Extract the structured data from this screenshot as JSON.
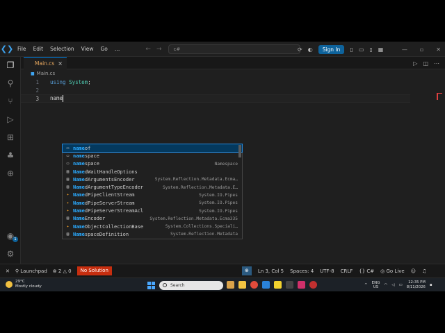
{
  "titlebar": {
    "menu": [
      "File",
      "Edit",
      "Selection",
      "View",
      "Go",
      "…"
    ],
    "search_text": "c#",
    "signin_label": "Sign In"
  },
  "tab": {
    "filename": "Main.cs",
    "close": "×"
  },
  "breadcrumb": {
    "file": "Main.cs"
  },
  "editor": {
    "lines": [
      {
        "num": "1",
        "keyword": "using",
        "ns": "System",
        "semi": ";"
      },
      {
        "num": "2"
      },
      {
        "num": "3",
        "text": "name"
      }
    ]
  },
  "suggest": {
    "items": [
      {
        "match": "name",
        "rest": "of",
        "detail": "",
        "icon": "keyword-icon"
      },
      {
        "match": "name",
        "rest": "space",
        "detail": "",
        "icon": "keyword-icon"
      },
      {
        "match": "name",
        "rest": "space",
        "detail": "Namespace",
        "icon": "snippet-icon"
      },
      {
        "match": "Name",
        "rest": "dWaitHandleOptions",
        "detail": "",
        "icon": "struct-icon"
      },
      {
        "match": "Name",
        "rest": "dArgumentsEncoder",
        "detail": "System.Reflection.Metadata.Ecma…",
        "icon": "struct-icon"
      },
      {
        "match": "Name",
        "rest": "dArgumentTypeEncoder",
        "detail": "System.Reflection.Metadata.E…",
        "icon": "struct-icon"
      },
      {
        "match": "Name",
        "rest": "dPipeClientStream",
        "detail": "System.IO.Pipes",
        "icon": "class-icon"
      },
      {
        "match": "Name",
        "rest": "dPipeServerStream",
        "detail": "System.IO.Pipes",
        "icon": "class-icon"
      },
      {
        "match": "Name",
        "rest": "dPipeServerStreamAcl",
        "detail": "System.IO.Pipes",
        "icon": "class-icon"
      },
      {
        "match": "Name",
        "rest": "Encoder",
        "detail": "System.Reflection.Metadata.Ecma335",
        "icon": "struct-icon"
      },
      {
        "match": "Name",
        "rest": "ObjectCollectionBase",
        "detail": "System.Collections.Speciali…",
        "icon": "class-icon"
      },
      {
        "match": "Name",
        "rest": "spaceDefinition",
        "detail": "System.Reflection.Metadata",
        "icon": "struct-icon"
      }
    ]
  },
  "statusbar": {
    "launchpad": "Launchpad",
    "errors": "2",
    "warnings": "0",
    "no_solution": "No Solution",
    "position": "Ln 3, Col 5",
    "spaces": "Spaces: 4",
    "encoding": "UTF-8",
    "eol": "CRLF",
    "language": "C#",
    "golive": "Go Live"
  },
  "taskbar": {
    "temp": "29°C",
    "weather": "Mostly cloudy",
    "search_placeholder": "Search",
    "lang": "ENG",
    "region": "US",
    "time": "12:35 PM",
    "date": "8/11/2026"
  }
}
